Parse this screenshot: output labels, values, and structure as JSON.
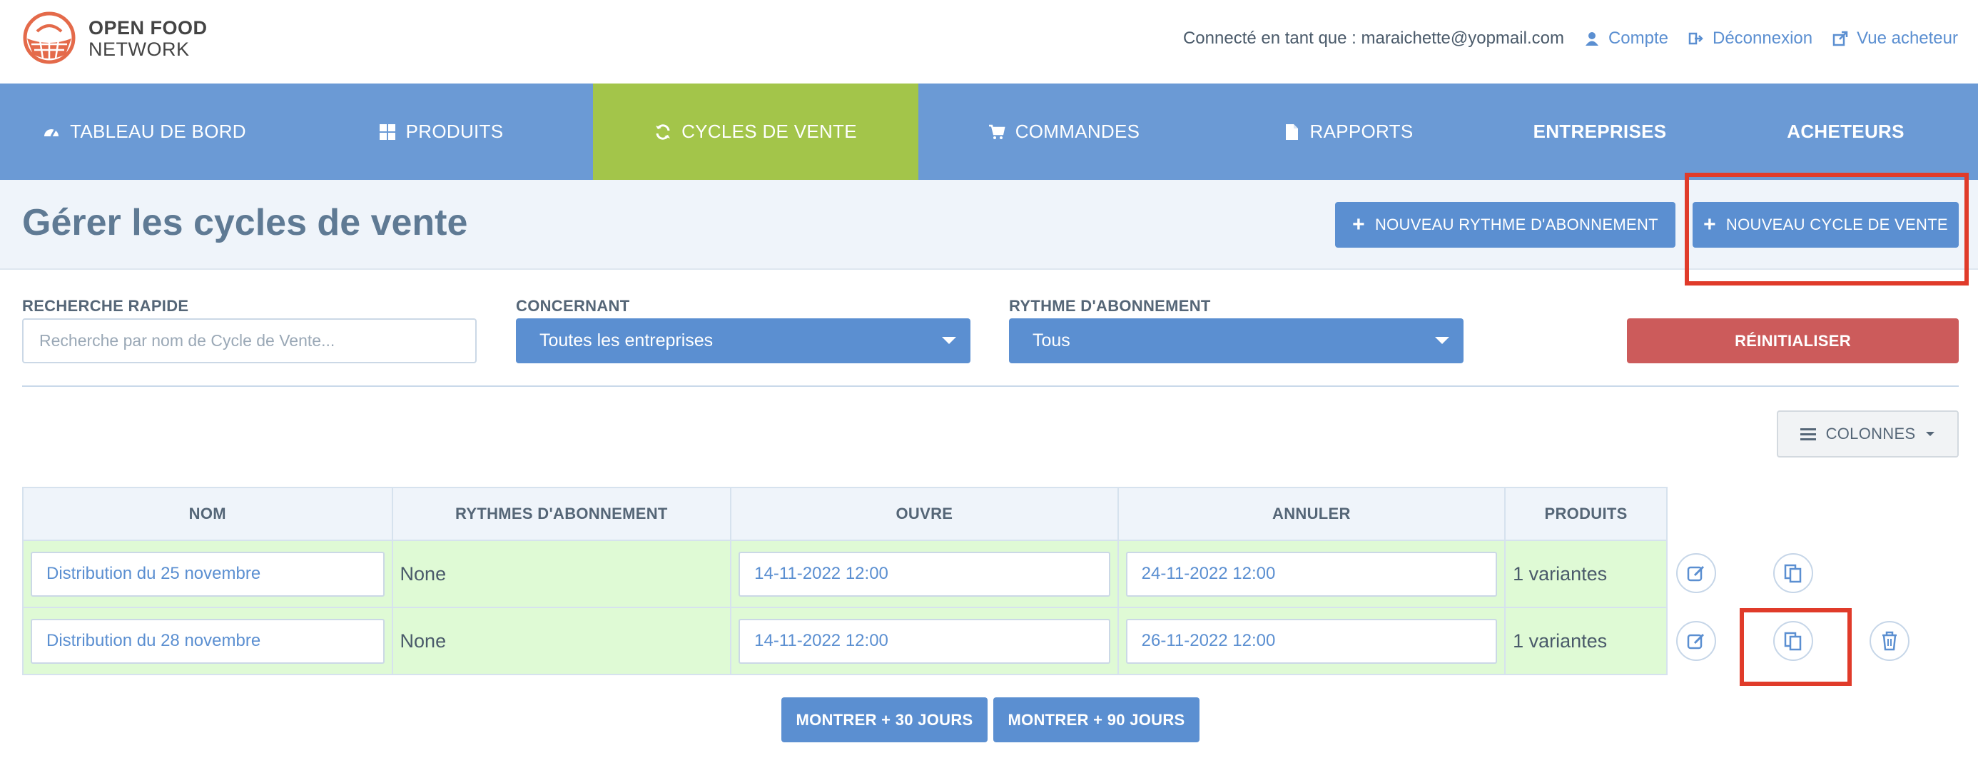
{
  "brand": {
    "line1": "OPEN FOOD",
    "line2": "NETWORK"
  },
  "userbar": {
    "connected": "Connecté en tant que : maraichette@yopmail.com",
    "account": "Compte",
    "logout": "Déconnexion",
    "shopfront": "Vue acheteur"
  },
  "nav": [
    {
      "label": "TABLEAU DE BORD",
      "icon": "dashboard-icon"
    },
    {
      "label": "PRODUITS",
      "icon": "grid-icon"
    },
    {
      "label": "CYCLES DE VENTE",
      "icon": "refresh-icon",
      "active": true
    },
    {
      "label": "COMMANDES",
      "icon": "cart-icon"
    },
    {
      "label": "RAPPORTS",
      "icon": "file-icon"
    },
    {
      "label": "ENTREPRISES"
    },
    {
      "label": "ACHETEURS"
    }
  ],
  "page": {
    "title": "Gérer les cycles de vente",
    "new_schedule": "NOUVEAU RYTHME D'ABONNEMENT",
    "new_cycle": "NOUVEAU CYCLE DE VENTE"
  },
  "filters": {
    "search_label": "RECHERCHE RAPIDE",
    "search_placeholder": "Recherche par nom de Cycle de Vente...",
    "concerning_label": "CONCERNANT",
    "concerning_value": "Toutes les entreprises",
    "schedule_label": "RYTHME D'ABONNEMENT",
    "schedule_value": "Tous",
    "reset": "RÉINITIALISER"
  },
  "columns_button": "COLONNES",
  "table": {
    "headers": [
      "NOM",
      "RYTHMES D'ABONNEMENT",
      "OUVRE",
      "ANNULER",
      "PRODUITS"
    ],
    "rows": [
      {
        "name": "Distribution du 25 novembre",
        "schedules": "None",
        "opens": "14-11-2022 12:00",
        "closes": "24-11-2022 12:00",
        "products": "1 variantes"
      },
      {
        "name": "Distribution du 28 novembre",
        "schedules": "None",
        "opens": "14-11-2022 12:00",
        "closes": "26-11-2022 12:00",
        "products": "1 variantes"
      }
    ]
  },
  "more": {
    "plus30": "MONTRER + 30 JOURS",
    "plus90": "MONTRER + 90 JOURS"
  },
  "colors": {
    "nav": "#6b9ad5",
    "active": "#a3c54a",
    "primary": "#5b8fd1",
    "danger": "#cc5b5b",
    "row": "#dffad5",
    "highlight": "#e03b2a"
  }
}
